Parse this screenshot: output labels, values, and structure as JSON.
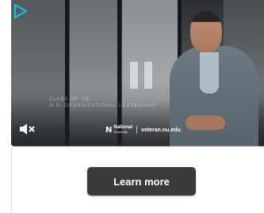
{
  "video": {
    "caption_line1": "CLASS OF '20",
    "caption_line2": "M.S. ORGANIZATIONAL LEADERSHIP",
    "brand_logo_letter": "N",
    "brand_name_line1": "National",
    "brand_name_line2": "University",
    "brand_url": "veteran.nu.edu",
    "progress_fraction": 0.0,
    "is_paused": false,
    "is_muted": true
  },
  "cta": {
    "label": "Learn more"
  },
  "colors": {
    "cta_background": "#3a3a3c",
    "cta_text": "#ffffff",
    "logo_accent": "#19b9d6"
  },
  "icons": {
    "top_left": "play-triangle-icon",
    "pause": "pause-icon",
    "mute": "muted-speaker-icon"
  }
}
